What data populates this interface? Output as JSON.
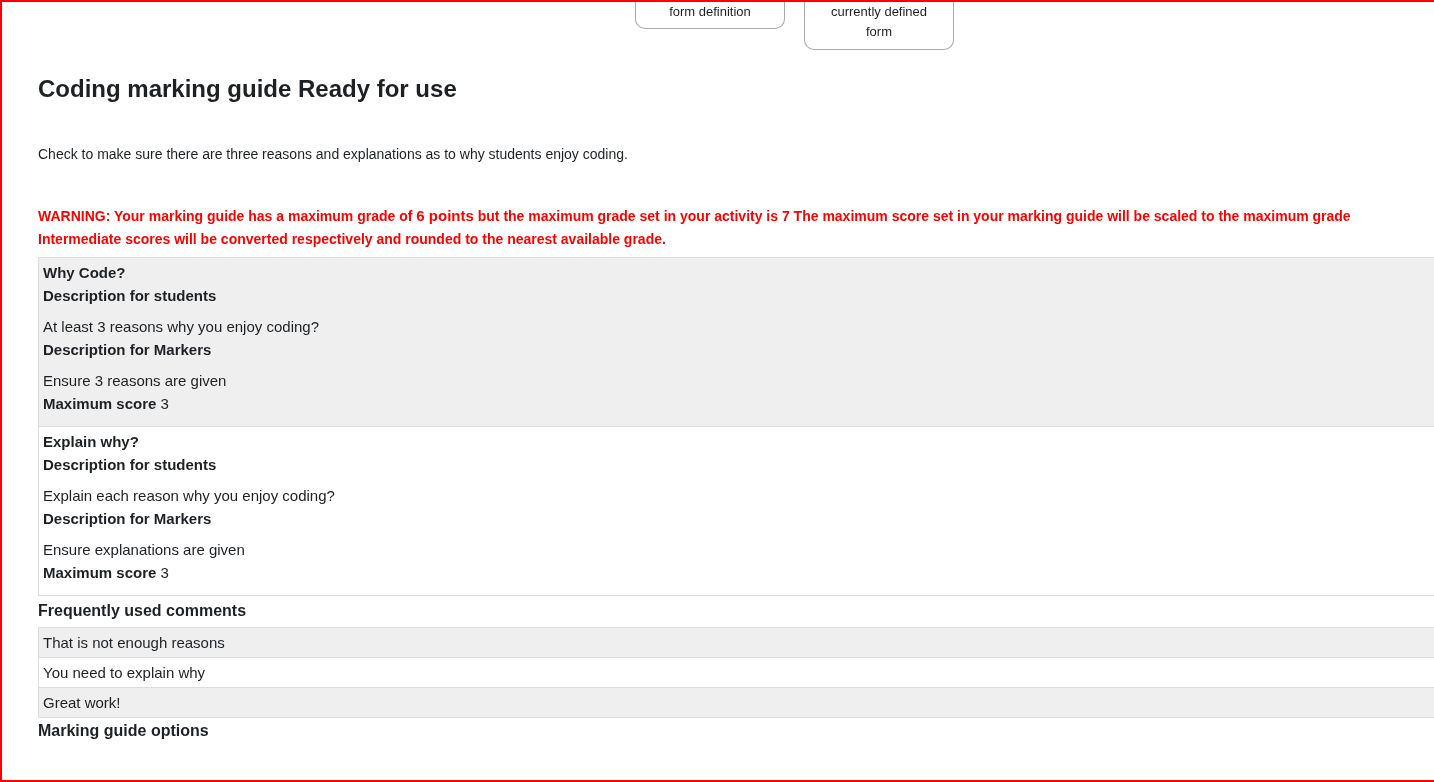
{
  "top_buttons": [
    "form definition",
    "currently defined form"
  ],
  "heading": "Coding marking guide Ready for use",
  "description": "Check to make sure there are three reasons and explanations as to why students enjoy coding.",
  "warning": [
    "WARNING: Your marking guide has a maximum grade of **6 points** but the maximum grade set in your activity is 7 The maximum score set in your marking guide will be scaled to the maximum grade",
    "Intermediate scores will be converted respectively and rounded to the nearest available grade."
  ],
  "criteria": [
    {
      "name": "Why Code?",
      "students_label": "Description for students",
      "students_text": "At least 3 reasons why you enjoy coding?",
      "markers_label": "Description for Markers",
      "markers_text": "Ensure 3 reasons are given",
      "max_label": "Maximum score",
      "max_value": "3"
    },
    {
      "name": "Explain why?",
      "students_label": "Description for students",
      "students_text": "Explain each reason why you enjoy coding?",
      "markers_label": "Description for Markers",
      "markers_text": "Ensure explanations are given",
      "max_label": "Maximum score",
      "max_value": "3"
    }
  ],
  "comments_heading": "Frequently used comments",
  "comments": [
    "That is not enough reasons",
    "You need to explain why",
    "Great work!"
  ],
  "options_heading": "Marking guide options"
}
